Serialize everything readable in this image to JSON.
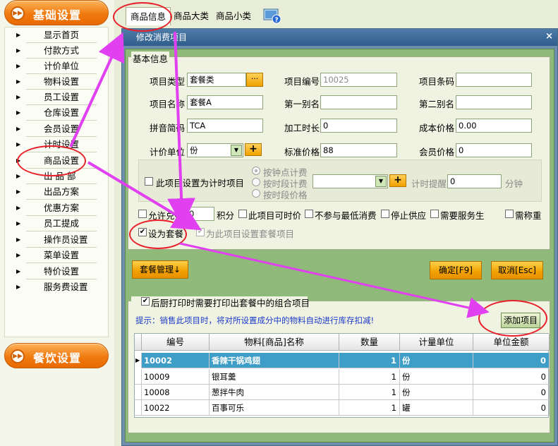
{
  "sidebar": {
    "group1_label": "基础设置",
    "group2_label": "餐饮设置",
    "items": [
      {
        "label": "显示首页"
      },
      {
        "label": "付款方式"
      },
      {
        "label": "计价单位"
      },
      {
        "label": "物料设置"
      },
      {
        "label": "员工设置"
      },
      {
        "label": "仓库设置"
      },
      {
        "label": "会员设置"
      },
      {
        "label": "计时设置"
      },
      {
        "label": "商品设置"
      },
      {
        "label": "出 品 部"
      },
      {
        "label": "出品方案"
      },
      {
        "label": "优惠方案"
      },
      {
        "label": "员工提成"
      },
      {
        "label": "操作员设置"
      },
      {
        "label": "菜单设置"
      },
      {
        "label": "特价设置"
      },
      {
        "label": "服务费设置"
      }
    ]
  },
  "tabs": [
    {
      "label": "商品信息"
    },
    {
      "label": "商品大类"
    },
    {
      "label": "商品小类"
    }
  ],
  "dialog": {
    "title": "修改消费项目",
    "close": "×",
    "basic_legend": "基本信息",
    "fields": {
      "item_type_label": "项目类型",
      "item_type_value": "套餐类",
      "item_no_label": "项目编号",
      "item_no_value": "10025",
      "barcode_label": "项目条码",
      "barcode_value": "",
      "name_label": "项目名称",
      "name_value": "套餐A",
      "alias1_label": "第一别名",
      "alias1_value": "",
      "alias2_label": "第二别名",
      "alias2_value": "",
      "pinyin_label": "拼音简码",
      "pinyin_value": "TCA",
      "process_time_label": "加工时长",
      "process_time_value": "0",
      "cost_label": "成本价格",
      "cost_value": "0.00",
      "unit_label": "计价单位",
      "unit_value": "份",
      "std_price_label": "标准价格",
      "std_price_value": "88",
      "member_price_label": "会员价格",
      "member_price_value": "0"
    },
    "timing": {
      "checkbox_label": "此项目设置为计时项目",
      "radio1": "按钟点计费",
      "radio2": "按时段计费",
      "radio3": "按时段价格",
      "remind_label": "计时提醒",
      "remind_value": "0",
      "remind_unit": "分钟"
    },
    "options": {
      "exchange_label": "允许兑换",
      "points_value": "0",
      "points_unit": "积分",
      "discount_label": "此项目可时价",
      "no_min_label": "不参与最低消费",
      "stop_label": "停止供应",
      "service_label": "需要服务生",
      "weigh_label": "需称重"
    },
    "set_combo_label": "设为套餐",
    "set_combo_items_label": "为此项目设置套餐项目",
    "combo_manage_button": "套餐管理↓",
    "confirm_button": "确定[F9]",
    "cancel_button": "取消[Esc]",
    "print_checkbox_label": "后厨打印时需要打印出套餐中的组合项目",
    "hint_text": "提示：销售此项目时，将对所设置成分中的物料自动进行库存扣减!",
    "add_item_button": "添加项目",
    "table": {
      "headers": [
        "编号",
        "物料[商品]名称",
        "数量",
        "计量单位",
        "单位金额"
      ],
      "rows": [
        {
          "code": "10002",
          "name": "香辣干锅鸡翅",
          "qty": "1",
          "unit": "份",
          "amount": "0"
        },
        {
          "code": "10009",
          "name": "银耳羹",
          "qty": "1",
          "unit": "份",
          "amount": "0"
        },
        {
          "code": "10008",
          "name": "葱拌牛肉",
          "qty": "1",
          "unit": "份",
          "amount": "0"
        },
        {
          "code": "10022",
          "name": "百事可乐",
          "qty": "1",
          "unit": "罐",
          "amount": "0"
        }
      ]
    }
  },
  "colors": {
    "accent_orange": "#f07a10",
    "annotation_red": "#e8202a",
    "annotation_magenta": "#e040f0",
    "selected_row": "#3f9ec8"
  }
}
